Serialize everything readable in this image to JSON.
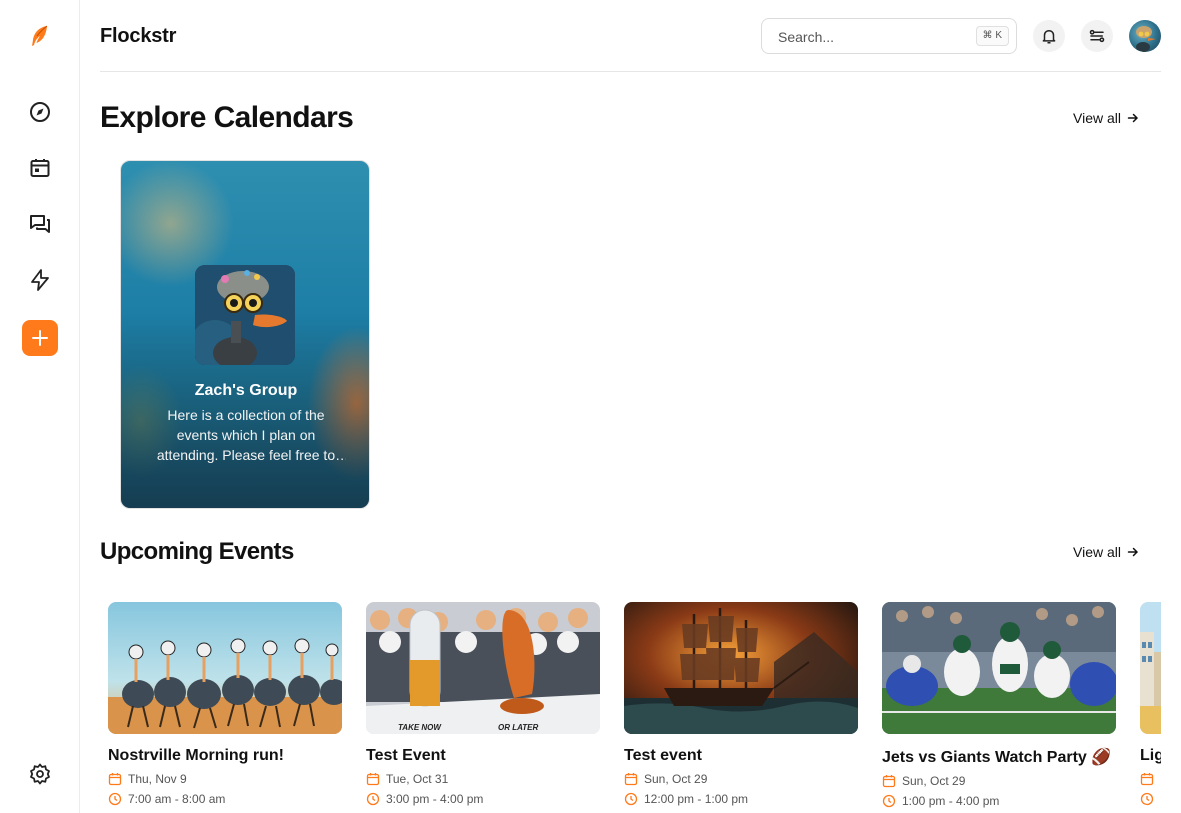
{
  "app": {
    "name": "Flockstr"
  },
  "colors": {
    "accent": "#ff7a1a",
    "border": "#e6e6e6",
    "text": "#111111",
    "muted": "#555555"
  },
  "sidebar": {
    "items": [
      {
        "icon": "compass-icon",
        "name": "explore"
      },
      {
        "icon": "calendar-icon",
        "name": "calendar"
      },
      {
        "icon": "messages-icon",
        "name": "messages"
      },
      {
        "icon": "lightning-icon",
        "name": "activity"
      },
      {
        "icon": "plus-icon",
        "name": "create"
      }
    ],
    "bottom": {
      "icon": "gear-icon",
      "name": "settings"
    }
  },
  "header": {
    "search": {
      "placeholder": "Search...",
      "shortcut": "⌘ K"
    },
    "icons": [
      "bell-icon",
      "toggle-settings-icon"
    ]
  },
  "explore": {
    "title": "Explore Calendars",
    "view_all": "View all",
    "calendars": [
      {
        "name": "Zach's Group",
        "description": "Here is a collection of the events which I plan on attending. Please feel free to join me!"
      }
    ]
  },
  "upcoming": {
    "title": "Upcoming Events",
    "view_all": "View all",
    "events": [
      {
        "title": "Nostrville Morning run!",
        "date": "Thu, Nov 9",
        "time": "7:00 am - 8:00 am"
      },
      {
        "title": "Test Event",
        "date": "Tue, Oct 31",
        "time": "3:00 pm - 4:00 pm"
      },
      {
        "title": "Test event",
        "date": "Sun, Oct 29",
        "time": "12:00 pm - 1:00 pm"
      },
      {
        "title": "Jets vs Giants Watch Party 🏈",
        "date": "Sun, Oct 29",
        "time": "1:00 pm - 4:00 pm"
      },
      {
        "title": "Lig",
        "date": "",
        "time": ""
      }
    ],
    "pill_labels": {
      "left": "TAKE NOW",
      "right": "OR LATER"
    }
  }
}
